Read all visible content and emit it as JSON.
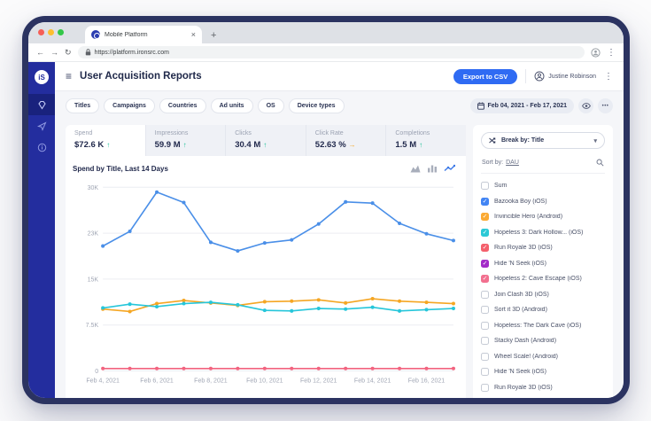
{
  "browser": {
    "tab_title": "Mobile Platform",
    "url": "https://platform.ironsrc.com"
  },
  "icons": {
    "hamburger": "≡",
    "kebab": "⋮",
    "meatball": "•••",
    "close": "×",
    "new_tab": "+",
    "back": "←",
    "forward": "→",
    "reload": "↻",
    "chevron_down": "▾",
    "check": "✓",
    "trend_up": "↑",
    "trend_flat": "→",
    "logo": "iS"
  },
  "colors": {
    "accent_blue": "#2f6bf3",
    "sidebar_navy": "#232d9e",
    "window_border": "#2b3361",
    "green_up": "#1fc198",
    "yellow_flat": "#f5a623"
  },
  "header": {
    "title": "User Acquisition Reports",
    "export_label": "Export to CSV",
    "user_name": "Justine Robinson"
  },
  "filters": {
    "chips": [
      "Titles",
      "Campaigns",
      "Countries",
      "Ad units",
      "OS",
      "Device types"
    ],
    "date_range": "Feb 04, 2021 - Feb 17, 2021"
  },
  "metrics": [
    {
      "label": "Spend",
      "value": "$72.6 K",
      "trend": "up",
      "active": true
    },
    {
      "label": "Impressions",
      "value": "59.9 M",
      "trend": "up",
      "active": false
    },
    {
      "label": "Clicks",
      "value": "30.4 M",
      "trend": "up",
      "active": false
    },
    {
      "label": "Click Rate",
      "value": "52.63 %",
      "trend": "flat",
      "active": false
    },
    {
      "label": "Completions",
      "value": "1.5 M",
      "trend": "up",
      "active": false
    }
  ],
  "breakdown_panel": {
    "break_by_label": "Break by: Title",
    "sort_by_prefix": "Sort by:",
    "sort_by_value": "DAU",
    "items": [
      {
        "label": "Sum",
        "checked": false,
        "color": null
      },
      {
        "label": "Bazooka Boy (iOS)",
        "checked": true,
        "color": "#4285f4"
      },
      {
        "label": "Invincible Hero (Android)",
        "checked": true,
        "color": "#fbaa33"
      },
      {
        "label": "Hopeless 3: Dark Hollow... (iOS)",
        "checked": true,
        "color": "#2bc9d6"
      },
      {
        "label": "Run Royale 3D (iOS)",
        "checked": true,
        "color": "#f4606c"
      },
      {
        "label": "Hide 'N Seek (iOS)",
        "checked": true,
        "color": "#a32bc8"
      },
      {
        "label": "Hopeless 2: Cave Escape (iOS)",
        "checked": true,
        "color": "#f2708f"
      },
      {
        "label": "Join Clash 3D (iOS)",
        "checked": false,
        "color": null
      },
      {
        "label": "Sort it 3D (Android)",
        "checked": false,
        "color": null
      },
      {
        "label": "Hopeless: The Dark Cave (iOS)",
        "checked": false,
        "color": null
      },
      {
        "label": "Stacky Dash (Android)",
        "checked": false,
        "color": null
      },
      {
        "label": "Wheel Scale! (Android)",
        "checked": false,
        "color": null
      },
      {
        "label": "Hide 'N Seek (iOS)",
        "checked": false,
        "color": null
      },
      {
        "label": "Run Royale 3D (iOS)",
        "checked": false,
        "color": null
      }
    ]
  },
  "chart_data": {
    "type": "line",
    "title": "Spend by Title, Last 14 Days",
    "x": [
      "Feb 4, 2021",
      "Feb 5, 2021",
      "Feb 6, 2021",
      "Feb 7, 2021",
      "Feb 8, 2021",
      "Feb 9, 2021",
      "Feb 10, 2021",
      "Feb 11, 2021",
      "Feb 12, 2021",
      "Feb 13, 2021",
      "Feb 14, 2021",
      "Feb 15, 2021",
      "Feb 16, 2021",
      "Feb 17, 2021"
    ],
    "x_tick_indices": [
      0,
      2,
      4,
      6,
      8,
      10,
      12
    ],
    "y_ticks": [
      {
        "label": "30K",
        "value": 30000
      },
      {
        "label": "23K",
        "value": 22500
      },
      {
        "label": "15K",
        "value": 15000
      },
      {
        "label": "7.5K",
        "value": 7500
      },
      {
        "label": "0",
        "value": 0
      }
    ],
    "ylim": [
      0,
      30000
    ],
    "grid": true,
    "legend": "checkbox-panel-right",
    "series": [
      {
        "name": "Bazooka Boy (iOS)",
        "color": "#4a8fe8",
        "values": [
          20400,
          22800,
          29200,
          27500,
          21000,
          19600,
          20900,
          21400,
          24000,
          27600,
          27400,
          24100,
          22400,
          21300
        ]
      },
      {
        "name": "Invincible Hero (Android)",
        "color": "#f5a623",
        "values": [
          10100,
          9700,
          11000,
          11500,
          11100,
          10700,
          11300,
          11400,
          11600,
          11100,
          11800,
          11400,
          11200,
          11000
        ]
      },
      {
        "name": "Hopeless 3: Dark Hollow... (iOS)",
        "color": "#26c6da",
        "values": [
          10300,
          10900,
          10500,
          11000,
          11200,
          10800,
          9900,
          9800,
          10200,
          10100,
          10400,
          9800,
          10000,
          10200
        ]
      },
      {
        "name": "Hopeless 2: Cave Escape (iOS)",
        "color": "#f2637f",
        "values": [
          400,
          400,
          400,
          400,
          400,
          400,
          400,
          400,
          400,
          400,
          400,
          400,
          400,
          400
        ]
      }
    ],
    "chart_type_options": [
      "area",
      "bar",
      "line"
    ],
    "active_chart_type": "line"
  }
}
